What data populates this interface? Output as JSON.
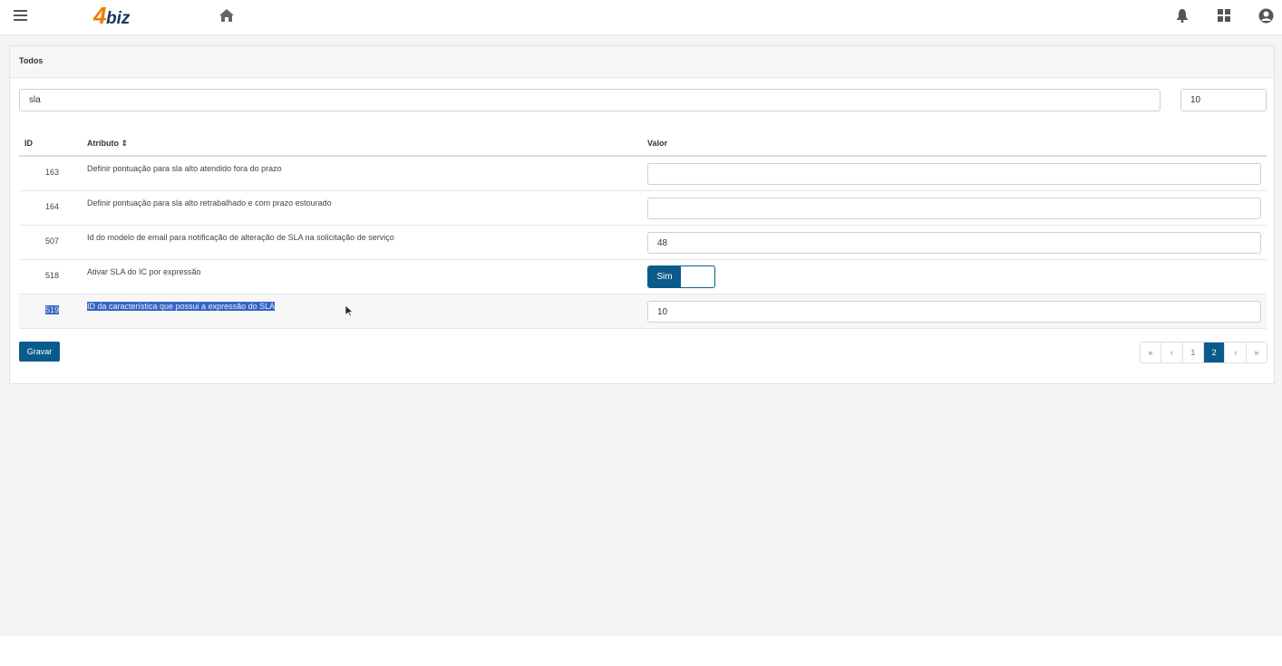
{
  "header": {
    "logo_num": "4",
    "logo_text": "biz",
    "icons": [
      "menu-icon",
      "home-icon",
      "bell-icon",
      "apps-grid-icon",
      "user-icon"
    ]
  },
  "panel": {
    "title": "Todos"
  },
  "search": {
    "value": "sla"
  },
  "page_size": {
    "value": "10"
  },
  "table": {
    "headers": {
      "id": "ID",
      "attribute": "Atributo ⇕",
      "value": "Valor"
    },
    "rows": [
      {
        "id": "163",
        "attribute": "Definir pontuação para sla alto atendido fora do prazo",
        "value": ""
      },
      {
        "id": "164",
        "attribute": "Definir pontuação para sla alto retrabalhado e com prazo estourado",
        "value": ""
      },
      {
        "id": "507",
        "attribute": "Id do modelo de email para notificação de alteração de SLA na solicitação de serviço",
        "value": "48"
      },
      {
        "id": "518",
        "attribute": "Ativar SLA do IC por expressão",
        "toggle_label": "Sim",
        "toggle_on": true
      },
      {
        "id": "519",
        "attribute": "ID da característica que possui a expressão do SLA",
        "value": "10",
        "selected": true
      }
    ]
  },
  "actions": {
    "save_label": "Gravar"
  },
  "pagination": {
    "first": "«",
    "prev": "‹",
    "pages": [
      "1",
      "2"
    ],
    "current": "2",
    "next": "›",
    "last": "»"
  },
  "colors": {
    "brand_primary": "#0a5b8c",
    "logo_orange": "#f07c00",
    "logo_navy": "#17375e",
    "selection": "#3464c8"
  }
}
